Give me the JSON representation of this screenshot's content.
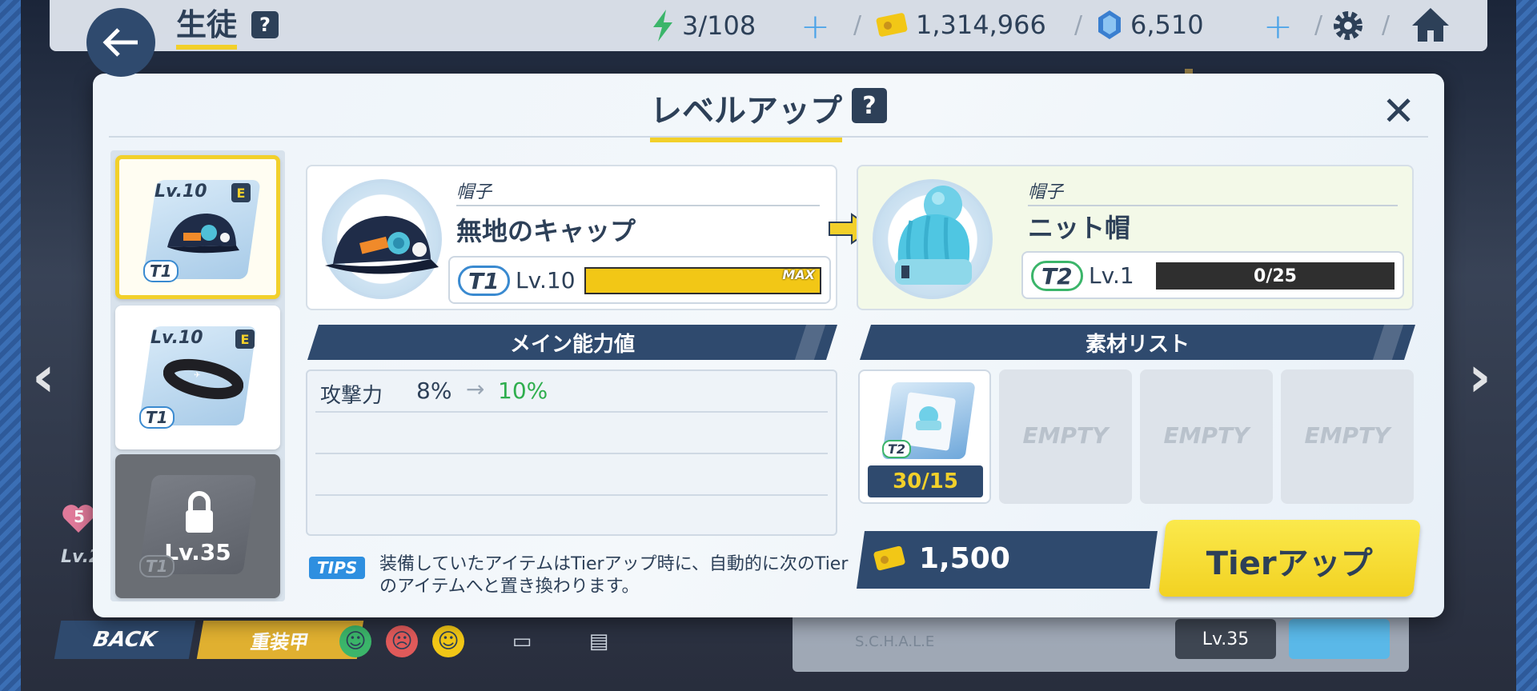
{
  "topbar": {
    "title": "生徒",
    "help": "?",
    "ap": "3/108",
    "credits": "1,314,966",
    "gems": "6,510"
  },
  "modal": {
    "title": "レベルアップ",
    "help": "?",
    "item_list": [
      {
        "level": "Lv.10",
        "grade": "E",
        "tier": "T1",
        "icon": "cap-icon",
        "selected": true
      },
      {
        "level": "Lv.10",
        "grade": "E",
        "tier": "T1",
        "icon": "headband-icon",
        "selected": false
      },
      {
        "level": "Lv.35",
        "tier": "T1",
        "icon": "watch-icon",
        "locked": true
      }
    ],
    "current": {
      "category": "帽子",
      "name": "無地のキャップ",
      "tier": "T1",
      "level": "Lv.10",
      "progress": 1.0,
      "progress_label": "MAX"
    },
    "next": {
      "category": "帽子",
      "name": "ニット帽",
      "tier": "T2",
      "level": "Lv.1",
      "exp": "0/25",
      "progress": 0.0
    },
    "stats_header": "メイン能力値",
    "stats": [
      {
        "label": "攻撃力",
        "from": "8%",
        "to": "10%"
      }
    ],
    "tips_badge": "TIPS",
    "tips_text": "装備していたアイテムはTierアップ時に、自動的に次のTierのアイテムへと置き換わります。",
    "materials_header": "素材リスト",
    "materials": [
      {
        "tier": "T2",
        "count": "30/15",
        "icon": "blueprint-icon"
      },
      {
        "empty": "EMPTY"
      },
      {
        "empty": "EMPTY"
      },
      {
        "empty": "EMPTY"
      }
    ],
    "cost": "1,500",
    "action_label": "Tierアップ"
  },
  "bottom": {
    "back_label": "BACK",
    "armor_label": "重装甲",
    "char_level_right": "Lv.35",
    "heart": "5",
    "char_level_left": "Lv.2",
    "schale": "S.C.H.A.L.E"
  },
  "colors": {
    "navy": "#2f4a6e",
    "yellow": "#f2d02a",
    "green": "#2fae4e",
    "blue": "#2e8fe0"
  }
}
